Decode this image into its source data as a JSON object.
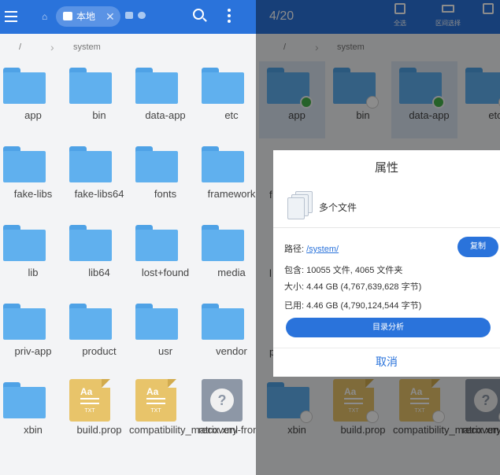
{
  "left": {
    "tab_label": "本地",
    "path_root": "/",
    "path_segment": "system",
    "items": [
      {
        "label": "app",
        "type": "folder"
      },
      {
        "label": "bin",
        "type": "folder"
      },
      {
        "label": "data-app",
        "type": "folder"
      },
      {
        "label": "etc",
        "type": "folder"
      },
      {
        "label": "fake-libs",
        "type": "folder"
      },
      {
        "label": "fake-libs64",
        "type": "folder"
      },
      {
        "label": "fonts",
        "type": "folder"
      },
      {
        "label": "framework",
        "type": "folder"
      },
      {
        "label": "lib",
        "type": "folder"
      },
      {
        "label": "lib64",
        "type": "folder"
      },
      {
        "label": "lost+found",
        "type": "folder"
      },
      {
        "label": "media",
        "type": "folder"
      },
      {
        "label": "priv-app",
        "type": "folder"
      },
      {
        "label": "product",
        "type": "folder"
      },
      {
        "label": "usr",
        "type": "folder"
      },
      {
        "label": "vendor",
        "type": "folder"
      },
      {
        "label": "xbin",
        "type": "folder"
      },
      {
        "label": "build.prop",
        "type": "txt"
      },
      {
        "label": "compatibility_matrix.xml",
        "type": "txt"
      },
      {
        "label": "recovery-from-",
        "type": "unknown"
      }
    ]
  },
  "right": {
    "counter": "4/20",
    "select_all": "全选",
    "range_select": "区间选择",
    "path_root": "/",
    "path_segment": "system",
    "items": [
      {
        "label": "app",
        "type": "folder",
        "checked": true
      },
      {
        "label": "bin",
        "type": "folder",
        "checked": false
      },
      {
        "label": "data-app",
        "type": "folder",
        "checked": true
      },
      {
        "label": "etc",
        "type": "folder",
        "checked": false
      },
      {
        "label": "xbin",
        "type": "folder",
        "checked": false
      },
      {
        "label": "build.prop",
        "type": "txt",
        "checked": false
      },
      {
        "label": "compatibility_matrix.xml",
        "type": "txt",
        "checked": false
      },
      {
        "label": "recovery-from-",
        "type": "unknown",
        "checked": false
      }
    ],
    "side_letters": [
      "f",
      "l",
      "p"
    ]
  },
  "dialog": {
    "title": "属性",
    "name": "多个文件",
    "path_label": "路径:",
    "path_value": "/system/",
    "copy": "复制",
    "contains": "包含: 10055 文件, 4065 文件夹",
    "size": "大小: 4.44 GB (4,767,639,628 字节)",
    "used": "已用: 4.46 GB (4,790,124,544 字节)",
    "analyze": "目录分析",
    "cancel": "取消"
  },
  "icons": {
    "txt_aa": "Aa",
    "txt_ext": "TXT",
    "unknown_glyph": "?"
  },
  "colors": {
    "accent": "#2a73db",
    "folder": "#60b0ee",
    "txt": "#e8c46a",
    "check": "#46b34b"
  }
}
